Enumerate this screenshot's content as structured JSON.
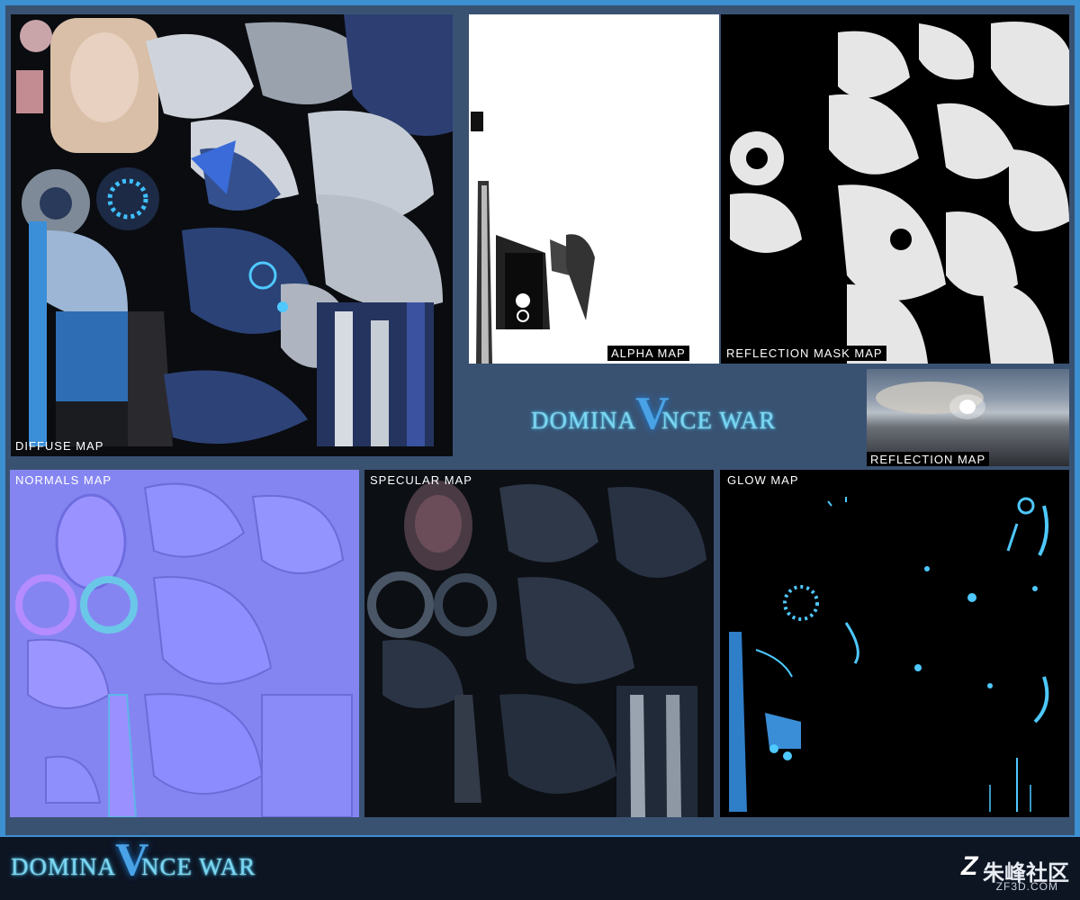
{
  "panels": {
    "diffuse": "DIFFUSE MAP",
    "alpha": "ALPHA MAP",
    "reflection_mask": "REFLECTION MASK MAP",
    "reflection": "REFLECTION MAP",
    "normals": "NORMALS MAP",
    "specular": "SPECULAR MAP",
    "glow": "GLOW MAP"
  },
  "logo": {
    "left": "DOMINA",
    "v": "V",
    "right": "NCE WAR"
  },
  "watermark": {
    "z": "Z",
    "name": "朱峰社区",
    "site": "ZF3D.COM"
  },
  "colors": {
    "accent": "#3c8fd0",
    "frame": "#3a5272",
    "normals": "#8585f2",
    "glow_cyan": "#4ec8ff"
  }
}
